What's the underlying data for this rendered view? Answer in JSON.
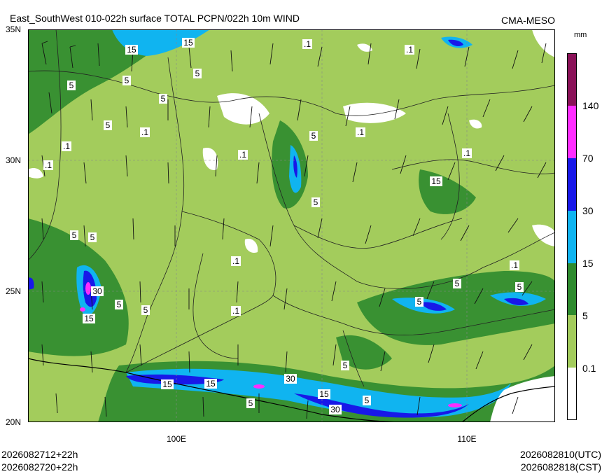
{
  "header": {
    "title": "East_SouthWest 010-022h surface TOTAL PCPN/022h 10m WIND",
    "model": "CMA-MESO",
    "unit": "mm"
  },
  "axes": {
    "lat_labels": [
      "35N",
      "30N",
      "25N",
      "20N"
    ],
    "lon_labels": [
      "100E",
      "110E"
    ]
  },
  "colorbar": {
    "levels": [
      "0.1",
      "5",
      "15",
      "30",
      "70",
      "140"
    ],
    "colors": [
      "#ffffff",
      "#a3cc5c",
      "#2e8b2e",
      "#10b4f0",
      "#1818e8",
      "#ff2cff",
      "#8a1258"
    ]
  },
  "map_labels": [
    "15",
    "15",
    "5",
    "5",
    "5",
    "5",
    "5",
    ".1",
    ".1",
    ".1",
    ".1",
    "30",
    "15",
    "5",
    "5",
    "30",
    "15",
    "5",
    "5",
    "15",
    "5",
    "30",
    "15",
    "5",
    "5",
    "5",
    "15",
    "5",
    "5",
    "5",
    "5",
    ".1",
    ".1",
    ".1",
    ".1",
    ".1",
    ".1",
    ".1"
  ],
  "footer": {
    "init_utc": "2026082712+22h",
    "init_cst": "2026082720+22h",
    "valid_utc": "2026082810(UTC)",
    "valid_cst": "2026082818(CST)"
  }
}
